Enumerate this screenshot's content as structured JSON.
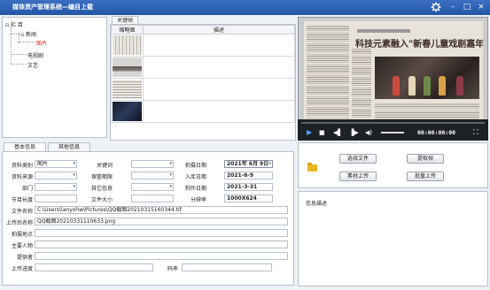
{
  "window": {
    "title": "媒体资产管理系统—编目上载"
  },
  "tree": {
    "root": "栏 目",
    "news": "新闻",
    "news_child": "图片",
    "tv": "电视剧",
    "arts": "文艺"
  },
  "thumb_tab": "关键帧",
  "thumb_headers": {
    "img": "缩略图",
    "desc": "描述"
  },
  "preview": {
    "headline": "科技元素融入\"新春儿童戏剧嘉年华\""
  },
  "player": {
    "time": "00:00:00:00"
  },
  "form_tabs": {
    "basic": "基本信息",
    "other": "其他信息"
  },
  "form": {
    "type_label": "资料类别",
    "type_value": "图片",
    "keyword_label": "关键词",
    "shoot_date_label": "拍摄日期",
    "shoot_date_value": "2021年 6月  9日",
    "source_label": "资料来源",
    "retention_label": "保管期限",
    "storage_date_label": "入库日期",
    "storage_date_value": "2021-6-9",
    "dept_label": "部门",
    "other_label": "其它信息",
    "made_date_label": "制作日期",
    "made_date_value": "2021-3-31",
    "length_label": "节目长度",
    "filesize_label": "文件大小",
    "resolution_label": "分辨率",
    "resolution_value": "1000X624",
    "filename_label": "文件名称",
    "filename_value": "C:\\Users\\lanyxhw\\Pictures\\QQ截图20210315160344.tif",
    "upload_label": "上传后名称",
    "upload_value": "QQ截图20210331110633.png",
    "location_label": "拍摄地点",
    "person_label": "主要人物",
    "provider_label": "提供者",
    "progress_label": "上传进度",
    "bitrate_label": "码率"
  },
  "actions": {
    "choose_file": "选择文件",
    "extract_frame": "提取帧",
    "upload_material": "素材上传",
    "batch_upload": "批量上传"
  },
  "info": {
    "title": "信息描述"
  }
}
